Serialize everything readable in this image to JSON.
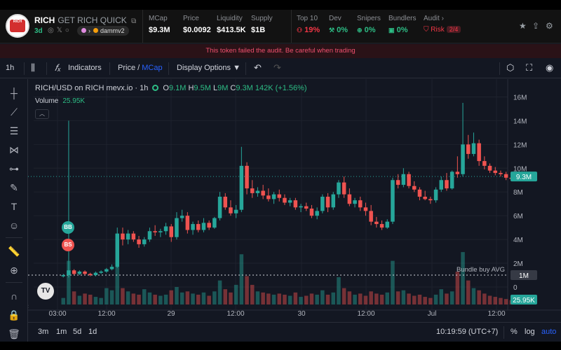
{
  "token": {
    "symbol": "RICH",
    "name": "GET RICH QUICK",
    "age": "3d",
    "dex_tag": "dammv2",
    "logo_text": "GET RICH QUICK"
  },
  "stats": {
    "mcap_label": "MCap",
    "mcap": "$9.3M",
    "price_label": "Price",
    "price": "$0.0092",
    "liquidity_label": "Liquidity",
    "liquidity": "$413.5K",
    "supply_label": "Supply",
    "supply": "$1B",
    "top10_label": "Top 10",
    "top10": "19%",
    "dev_label": "Dev",
    "dev": "0%",
    "snipers_label": "Snipers",
    "snipers": "0%",
    "bundlers_label": "Bundlers",
    "bundlers": "0%",
    "audit_label": "Audit",
    "risk_label": "Risk",
    "risk_value": "2/4"
  },
  "warning": "This token failed the audit. Be careful when trading",
  "toolbar": {
    "interval": "1h",
    "indicators": "Indicators",
    "price_label": "Price /",
    "mcap_label": "MCap",
    "display_options": "Display Options"
  },
  "legend": {
    "pair": "RICH/USD on RICH mevx.io · 1h",
    "o_label": "O",
    "o": "9.1M",
    "h_label": "H",
    "h": "9.5M",
    "l_label": "L",
    "l": "9M",
    "c_label": "C",
    "c": "9.3M",
    "change": "142K (+1.56%)",
    "volume_label": "Volume",
    "volume_value": "25.95K"
  },
  "markers": {
    "bb": "BB",
    "bs": "BS",
    "bundle_label": "Bundle buy AVG"
  },
  "bottom": {
    "ranges": [
      "3m",
      "1m",
      "5d",
      "1d"
    ],
    "time": "10:19:59 (UTC+7)",
    "percent": "%",
    "log": "log",
    "auto": "auto"
  },
  "colors": {
    "up": "#26a69a",
    "down": "#ef5350",
    "background": "#131722",
    "accent": "#2962ff"
  },
  "chart_data": {
    "type": "candlestick",
    "interval": "1h",
    "y_unit": "market cap (USD)",
    "ylim": [
      0,
      17000000
    ],
    "y_ticks": [
      "16M",
      "14M",
      "12M",
      "10M",
      "8M",
      "6M",
      "4M",
      "2M",
      "0"
    ],
    "x_ticks": [
      "03:00",
      "12:00",
      "29",
      "12:00",
      "30",
      "12:00",
      "Jul",
      "12:00"
    ],
    "last_price_label": "9.3M",
    "last_price": 9300000,
    "bundle_buy_avg_label": "1M",
    "bundle_buy_avg": 1000000,
    "volume_last_label": "25.95K",
    "candles": [
      [
        900000,
        1100000,
        800000,
        1000000,
        6000
      ],
      [
        1000000,
        14000000,
        800000,
        1400000,
        40000
      ],
      [
        1400000,
        1500000,
        1000000,
        1100000,
        12000
      ],
      [
        1100000,
        1400000,
        1000000,
        1300000,
        8000
      ],
      [
        1300000,
        1400000,
        1000000,
        1100000,
        10000
      ],
      [
        1100000,
        1200000,
        900000,
        1000000,
        9000
      ],
      [
        1000000,
        1300000,
        900000,
        1200000,
        7000
      ],
      [
        1200000,
        1400000,
        1100000,
        1300000,
        6000
      ],
      [
        1300000,
        1600000,
        1200000,
        1500000,
        15000
      ],
      [
        1500000,
        1900000,
        1400000,
        1700000,
        13000
      ],
      [
        1700000,
        5000000,
        1600000,
        4500000,
        38000
      ],
      [
        4500000,
        5000000,
        3500000,
        4000000,
        15000
      ],
      [
        4000000,
        4800000,
        3600000,
        4500000,
        12000
      ],
      [
        4500000,
        4700000,
        3800000,
        4000000,
        10000
      ],
      [
        4000000,
        4300000,
        3300000,
        3600000,
        9000
      ],
      [
        3600000,
        4200000,
        3400000,
        4000000,
        14000
      ],
      [
        4000000,
        5000000,
        3800000,
        4700000,
        11000
      ],
      [
        4700000,
        5200000,
        4300000,
        4600000,
        9000
      ],
      [
        4600000,
        4900000,
        4200000,
        4700000,
        8000
      ],
      [
        4700000,
        5400000,
        4400000,
        5100000,
        9000
      ],
      [
        5100000,
        5300000,
        3800000,
        4200000,
        13000
      ],
      [
        4200000,
        6300000,
        4000000,
        5800000,
        16000
      ],
      [
        5800000,
        6500000,
        5500000,
        6000000,
        11000
      ],
      [
        6000000,
        6300000,
        4500000,
        4800000,
        12000
      ],
      [
        4800000,
        5500000,
        4400000,
        5300000,
        10000
      ],
      [
        5300000,
        5600000,
        4600000,
        4800000,
        9000
      ],
      [
        4800000,
        5800000,
        4600000,
        5400000,
        11000
      ],
      [
        5400000,
        5600000,
        4800000,
        5000000,
        8000
      ],
      [
        5000000,
        5900000,
        4900000,
        5800000,
        12000
      ],
      [
        5800000,
        8000000,
        5600000,
        7600000,
        22000
      ],
      [
        7600000,
        7900000,
        6500000,
        6700000,
        14000
      ],
      [
        6700000,
        7300000,
        6000000,
        6200000,
        11000
      ],
      [
        6200000,
        6900000,
        5800000,
        6500000,
        18000
      ],
      [
        6500000,
        11800000,
        6300000,
        10200000,
        46000
      ],
      [
        10200000,
        10500000,
        7800000,
        8300000,
        26000
      ],
      [
        8300000,
        9000000,
        7500000,
        7900000,
        18000
      ],
      [
        7900000,
        8400000,
        7600000,
        8100000,
        12000
      ],
      [
        8100000,
        8600000,
        7400000,
        7700000,
        11000
      ],
      [
        7700000,
        8300000,
        7200000,
        7400000,
        10000
      ],
      [
        7400000,
        8000000,
        7000000,
        7800000,
        9000
      ],
      [
        7800000,
        8200000,
        7200000,
        7500000,
        10000
      ],
      [
        7500000,
        7800000,
        6900000,
        7100000,
        9000
      ],
      [
        7100000,
        7500000,
        6800000,
        7300000,
        8000
      ],
      [
        7300000,
        7500000,
        6500000,
        6700000,
        11000
      ],
      [
        6700000,
        7000000,
        6300000,
        6800000,
        7000
      ],
      [
        6800000,
        7100000,
        6400000,
        6600000,
        8000
      ],
      [
        6600000,
        6900000,
        5800000,
        6000000,
        10000
      ],
      [
        6000000,
        6700000,
        5700000,
        6400000,
        9000
      ],
      [
        6400000,
        7800000,
        6200000,
        7600000,
        13000
      ],
      [
        7600000,
        7900000,
        6300000,
        6700000,
        9000
      ],
      [
        6700000,
        8000000,
        6500000,
        7800000,
        11000
      ],
      [
        7800000,
        9000000,
        7500000,
        8800000,
        25000
      ],
      [
        8800000,
        9300000,
        7500000,
        7800000,
        15000
      ],
      [
        7800000,
        8300000,
        6800000,
        7000000,
        12000
      ],
      [
        7000000,
        7500000,
        6700000,
        7300000,
        9000
      ],
      [
        7300000,
        7600000,
        6400000,
        6700000,
        10000
      ],
      [
        6700000,
        7100000,
        6000000,
        6400000,
        8000
      ],
      [
        6400000,
        6900000,
        5200000,
        5500000,
        12000
      ],
      [
        5500000,
        5900000,
        5000000,
        5300000,
        10000
      ],
      [
        5300000,
        5600000,
        4800000,
        5000000,
        9000
      ],
      [
        5000000,
        5700000,
        4900000,
        5500000,
        11000
      ],
      [
        5500000,
        9200000,
        5300000,
        9000000,
        40000
      ],
      [
        9000000,
        9500000,
        8300000,
        8600000,
        12000
      ],
      [
        8600000,
        10000000,
        8400000,
        9500000,
        13000
      ],
      [
        9500000,
        9700000,
        8300000,
        8500000,
        10000
      ],
      [
        8500000,
        8900000,
        8000000,
        8200000,
        8000
      ],
      [
        8200000,
        8400000,
        7300000,
        7600000,
        9000
      ],
      [
        7600000,
        8100000,
        7300000,
        7400000,
        7000
      ],
      [
        7400000,
        7600000,
        7000000,
        7300000,
        6000
      ],
      [
        7300000,
        8400000,
        7100000,
        8200000,
        9000
      ],
      [
        8200000,
        9300000,
        8000000,
        9000000,
        14000
      ],
      [
        9000000,
        9600000,
        8100000,
        8300000,
        10000
      ],
      [
        8300000,
        9800000,
        8200000,
        9700000,
        12000
      ],
      [
        9700000,
        11000000,
        9200000,
        9500000,
        30000
      ],
      [
        9500000,
        15500000,
        9300000,
        12000000,
        48000
      ],
      [
        12000000,
        12800000,
        10800000,
        11200000,
        22000
      ],
      [
        11200000,
        13000000,
        11000000,
        12100000,
        15000
      ],
      [
        12100000,
        12400000,
        10200000,
        10600000,
        13000
      ],
      [
        10600000,
        11000000,
        9900000,
        10200000,
        10000
      ],
      [
        10200000,
        10400000,
        9600000,
        9800000,
        8000
      ],
      [
        9800000,
        10100000,
        9400000,
        9600000,
        7000
      ],
      [
        9600000,
        9800000,
        9300000,
        9500000,
        6000
      ],
      [
        9500000,
        9700000,
        9000000,
        9200000,
        5000
      ],
      [
        9200000,
        9500000,
        8900000,
        9100000,
        4000
      ],
      [
        9100000,
        9500000,
        9000000,
        9300000,
        3000
      ]
    ]
  }
}
